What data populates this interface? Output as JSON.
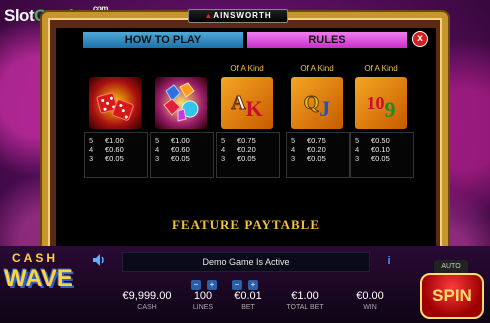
{
  "brand": {
    "part1": "Slot",
    "part2": "Catalog",
    "suffix": "com"
  },
  "provider_logo": "AINSWORTH",
  "tabs": {
    "how_to_play": "HOW TO PLAY",
    "rules": "RULES"
  },
  "close_label": "x",
  "symbols": [
    {
      "name": "dice",
      "kind_label": "",
      "pays": [
        {
          "count": "5",
          "value": "€1.00"
        },
        {
          "count": "4",
          "value": "€0.60"
        },
        {
          "count": "3",
          "value": "€0.05"
        }
      ]
    },
    {
      "name": "gems",
      "kind_label": "",
      "pays": [
        {
          "count": "5",
          "value": "€1.00"
        },
        {
          "count": "4",
          "value": "€0.60"
        },
        {
          "count": "3",
          "value": "€0.05"
        }
      ]
    },
    {
      "name": "ace-king",
      "kind_label": "Of A Kind",
      "pays": [
        {
          "count": "5",
          "value": "€0.75"
        },
        {
          "count": "4",
          "value": "€0.20"
        },
        {
          "count": "3",
          "value": "€0.05"
        }
      ]
    },
    {
      "name": "queen-jack",
      "kind_label": "Of A Kind",
      "pays": [
        {
          "count": "5",
          "value": "€0.75"
        },
        {
          "count": "4",
          "value": "€0.20"
        },
        {
          "count": "3",
          "value": "€0.05"
        }
      ]
    },
    {
      "name": "ten-nine",
      "kind_label": "Of A Kind",
      "pays": [
        {
          "count": "5",
          "value": "€0.50"
        },
        {
          "count": "4",
          "value": "€0.10"
        },
        {
          "count": "3",
          "value": "€0.05"
        }
      ]
    }
  ],
  "symbol_glyphs": {
    "ace": "A",
    "king": "K",
    "queen": "Q",
    "jack": "J",
    "ten": "10",
    "nine": "9"
  },
  "feature_title": "FEATURE PAYTABLE",
  "game_logo": {
    "line1": "CASH",
    "line2": "WAVE"
  },
  "message": "Demo Game Is Active",
  "info_label": "i",
  "auto_label": "AUTO",
  "spin_label": "SPIN",
  "stats": {
    "cash": {
      "value": "€9,999.00",
      "label": "CASH"
    },
    "lines": {
      "value": "100",
      "label": "LINES"
    },
    "bet": {
      "value": "€0.01",
      "label": "BET"
    },
    "total_bet": {
      "value": "€1.00",
      "label": "TOTAL BET"
    },
    "win": {
      "value": "€0.00",
      "label": "WIN"
    }
  },
  "stepper_labels": {
    "minus": "−",
    "plus": "+"
  },
  "colors": {
    "gold": "#f1c232",
    "tab_blue": "#1c6fa8",
    "tab_pink": "#c82fc8",
    "accent_red": "#d51f1f"
  }
}
